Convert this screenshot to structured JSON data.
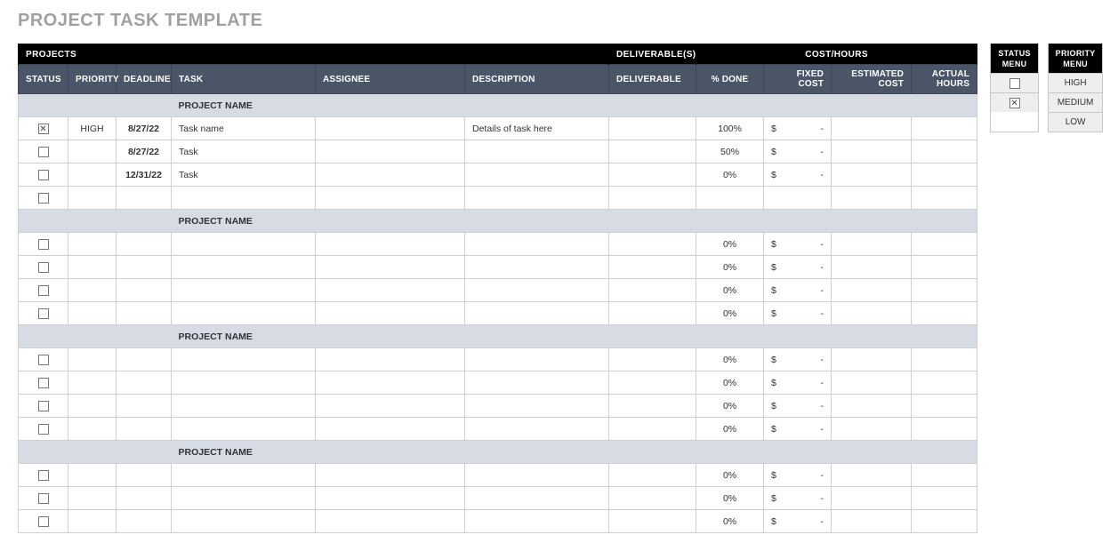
{
  "title": "PROJECT TASK TEMPLATE",
  "header_bar": {
    "projects": "PROJECTS",
    "deliverables": "DELIVERABLE(S)",
    "cost_hours": "COST/HOURS"
  },
  "columns": {
    "status": "STATUS",
    "priority": "PRIORITY",
    "deadline": "DEADLINE",
    "task": "TASK",
    "assignee": "ASSIGNEE",
    "description": "DESCRIPTION",
    "deliverable": "DELIVERABLE",
    "pct_done": "% DONE",
    "fixed_cost": "FIXED COST",
    "estimated_cost": "ESTIMATED COST",
    "actual_hours": "ACTUAL HOURS"
  },
  "sections": [
    {
      "name": "PROJECT NAME",
      "rows": [
        {
          "status_checked": true,
          "priority": "HIGH",
          "deadline": "8/27/22",
          "task": "Task name",
          "assignee": "",
          "description": "Details of task here",
          "deliverable": "",
          "pct_done": "100%",
          "fixed_currency": "$",
          "fixed_dash": "-",
          "estimated": "",
          "actual": ""
        },
        {
          "status_checked": false,
          "priority": "",
          "deadline": "8/27/22",
          "task": "Task",
          "assignee": "",
          "description": "",
          "deliverable": "",
          "pct_done": "50%",
          "fixed_currency": "$",
          "fixed_dash": "-",
          "estimated": "",
          "actual": ""
        },
        {
          "status_checked": false,
          "priority": "",
          "deadline": "12/31/22",
          "task": "Task",
          "assignee": "",
          "description": "",
          "deliverable": "",
          "pct_done": "0%",
          "fixed_currency": "$",
          "fixed_dash": "-",
          "estimated": "",
          "actual": ""
        },
        {
          "status_checked": false,
          "priority": "",
          "deadline": "",
          "task": "",
          "assignee": "",
          "description": "",
          "deliverable": "",
          "pct_done": "",
          "fixed_currency": "",
          "fixed_dash": "",
          "estimated": "",
          "actual": ""
        }
      ]
    },
    {
      "name": "PROJECT NAME",
      "rows": [
        {
          "status_checked": false,
          "priority": "",
          "deadline": "",
          "task": "",
          "assignee": "",
          "description": "",
          "deliverable": "",
          "pct_done": "0%",
          "fixed_currency": "$",
          "fixed_dash": "-",
          "estimated": "",
          "actual": ""
        },
        {
          "status_checked": false,
          "priority": "",
          "deadline": "",
          "task": "",
          "assignee": "",
          "description": "",
          "deliverable": "",
          "pct_done": "0%",
          "fixed_currency": "$",
          "fixed_dash": "-",
          "estimated": "",
          "actual": ""
        },
        {
          "status_checked": false,
          "priority": "",
          "deadline": "",
          "task": "",
          "assignee": "",
          "description": "",
          "deliverable": "",
          "pct_done": "0%",
          "fixed_currency": "$",
          "fixed_dash": "-",
          "estimated": "",
          "actual": ""
        },
        {
          "status_checked": false,
          "priority": "",
          "deadline": "",
          "task": "",
          "assignee": "",
          "description": "",
          "deliverable": "",
          "pct_done": "0%",
          "fixed_currency": "$",
          "fixed_dash": "-",
          "estimated": "",
          "actual": ""
        }
      ]
    },
    {
      "name": "PROJECT NAME",
      "rows": [
        {
          "status_checked": false,
          "priority": "",
          "deadline": "",
          "task": "",
          "assignee": "",
          "description": "",
          "deliverable": "",
          "pct_done": "0%",
          "fixed_currency": "$",
          "fixed_dash": "-",
          "estimated": "",
          "actual": ""
        },
        {
          "status_checked": false,
          "priority": "",
          "deadline": "",
          "task": "",
          "assignee": "",
          "description": "",
          "deliverable": "",
          "pct_done": "0%",
          "fixed_currency": "$",
          "fixed_dash": "-",
          "estimated": "",
          "actual": ""
        },
        {
          "status_checked": false,
          "priority": "",
          "deadline": "",
          "task": "",
          "assignee": "",
          "description": "",
          "deliverable": "",
          "pct_done": "0%",
          "fixed_currency": "$",
          "fixed_dash": "-",
          "estimated": "",
          "actual": ""
        },
        {
          "status_checked": false,
          "priority": "",
          "deadline": "",
          "task": "",
          "assignee": "",
          "description": "",
          "deliverable": "",
          "pct_done": "0%",
          "fixed_currency": "$",
          "fixed_dash": "-",
          "estimated": "",
          "actual": ""
        }
      ]
    },
    {
      "name": "PROJECT NAME",
      "rows": [
        {
          "status_checked": false,
          "priority": "",
          "deadline": "",
          "task": "",
          "assignee": "",
          "description": "",
          "deliverable": "",
          "pct_done": "0%",
          "fixed_currency": "$",
          "fixed_dash": "-",
          "estimated": "",
          "actual": ""
        },
        {
          "status_checked": false,
          "priority": "",
          "deadline": "",
          "task": "",
          "assignee": "",
          "description": "",
          "deliverable": "",
          "pct_done": "0%",
          "fixed_currency": "$",
          "fixed_dash": "-",
          "estimated": "",
          "actual": ""
        },
        {
          "status_checked": false,
          "priority": "",
          "deadline": "",
          "task": "",
          "assignee": "",
          "description": "",
          "deliverable": "",
          "pct_done": "0%",
          "fixed_currency": "$",
          "fixed_dash": "-",
          "estimated": "",
          "actual": ""
        }
      ]
    }
  ],
  "status_menu": {
    "title": "STATUS MENU",
    "rows": [
      {
        "checked": false
      },
      {
        "checked": true
      }
    ]
  },
  "priority_menu": {
    "title": "PRIORITY MENU",
    "options": [
      "HIGH",
      "MEDIUM",
      "LOW"
    ]
  }
}
